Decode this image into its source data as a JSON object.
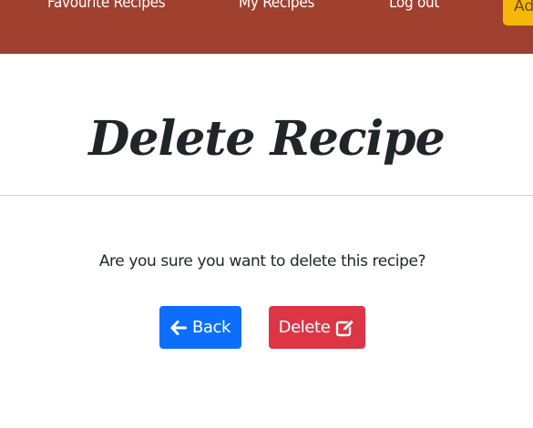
{
  "navbar": {
    "links": {
      "favourites": "Favourite Recipes",
      "my_recipes": "My Recipes",
      "logout": "Log out"
    },
    "add_button_label": "Ad",
    "background_color": "#a0402e",
    "add_button_color": "#f5b80a"
  },
  "page": {
    "title": "Delete Recipe",
    "question": "Are you sure you want to delete this recipe?"
  },
  "actions": {
    "back_label": "Back",
    "back_icon": "arrow-left-icon",
    "back_color": "#0d6efd",
    "delete_label": "Delete",
    "delete_icon": "edit-icon",
    "delete_color": "#dc3545"
  }
}
